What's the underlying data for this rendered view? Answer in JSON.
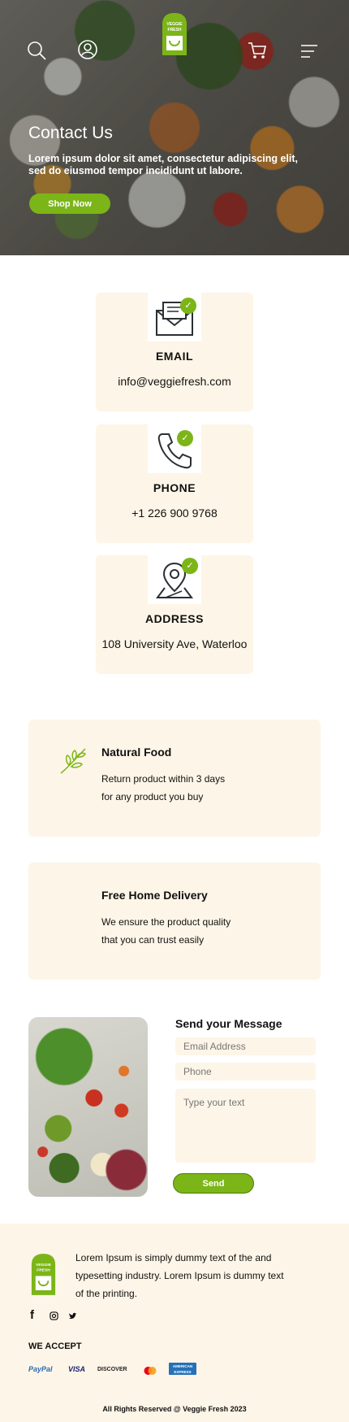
{
  "brand": {
    "logo_line1": "VEGGIE",
    "logo_line2": "FRESH",
    "accent": "#7cb518",
    "card_bg": "#fdf5e7"
  },
  "nav": {
    "icons": [
      "search-icon",
      "user-icon",
      "cart-icon",
      "menu-icon"
    ]
  },
  "hero": {
    "title": "Contact Us",
    "text": "Lorem ipsum dolor sit amet, consectetur adipiscing elit, sed do eiusmod tempor incididunt ut labore.",
    "button": "Shop Now"
  },
  "contacts": [
    {
      "icon": "envelope-icon",
      "title": "EMAIL",
      "value": "info@veggiefresh.com"
    },
    {
      "icon": "phone-icon",
      "title": "PHONE",
      "value": "+1 226 900 9768"
    },
    {
      "icon": "map-pin-icon",
      "title": "ADDRESS",
      "value": "108 University Ave, Waterloo"
    }
  ],
  "features": [
    {
      "icon": "leaf-icon",
      "title": "Natural Food",
      "line1": "Return product within 3 days",
      "line2": "for any product you buy"
    },
    {
      "icon": "",
      "title": "Free Home Delivery",
      "line1": "We ensure the product quality",
      "line2": "that you can trust easily"
    }
  ],
  "form": {
    "title": "Send your Message",
    "email_placeholder": "Email Address",
    "phone_placeholder": "Phone",
    "message_placeholder": "Type your text",
    "send": "Send"
  },
  "footer": {
    "text": "Lorem Ipsum is simply dummy text of the and typesetting industry. Lorem Ipsum is dummy text of the printing.",
    "social": [
      "facebook-icon",
      "instagram-icon",
      "twitter-icon"
    ],
    "we_accept": "WE ACCEPT",
    "payments": [
      "PayPal",
      "VISA",
      "DISCOVER",
      "mastercard",
      "AMERICAN EXPRESS"
    ],
    "copyright": "All Rights Reserved @ Veggie Fresh 2023"
  }
}
